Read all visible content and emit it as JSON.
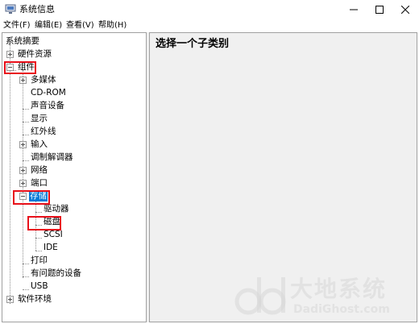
{
  "window": {
    "title": "系统信息"
  },
  "menu": {
    "file": "文件(F)",
    "edit": "编辑(E)",
    "view": "查看(V)",
    "help": "帮助(H)"
  },
  "tree": {
    "root": "系统摘要",
    "items": [
      {
        "label": "硬件资源",
        "expander": "plus"
      },
      {
        "label": "组件",
        "expander": "minus"
      },
      {
        "label": "多媒体",
        "expander": "plus"
      },
      {
        "label": "CD-ROM"
      },
      {
        "label": "声音设备"
      },
      {
        "label": "显示"
      },
      {
        "label": "红外线"
      },
      {
        "label": "输入",
        "expander": "plus"
      },
      {
        "label": "调制解调器"
      },
      {
        "label": "网络",
        "expander": "plus"
      },
      {
        "label": "端口",
        "expander": "plus"
      },
      {
        "label": "存储",
        "expander": "minus",
        "selected": true
      },
      {
        "label": "驱动器"
      },
      {
        "label": "磁盘"
      },
      {
        "label": "SCSI"
      },
      {
        "label": "IDE"
      },
      {
        "label": "打印"
      },
      {
        "label": "有问题的设备"
      },
      {
        "label": "USB"
      },
      {
        "label": "软件环境",
        "expander": "plus"
      }
    ]
  },
  "content": {
    "heading": "选择一个子类别"
  },
  "watermark": {
    "cn": "大地系统",
    "en": "DadiGhost.com"
  },
  "colors": {
    "selection": "#0078d7",
    "highlight_box": "#e8101a",
    "pane_background": "#f0f0f0"
  }
}
